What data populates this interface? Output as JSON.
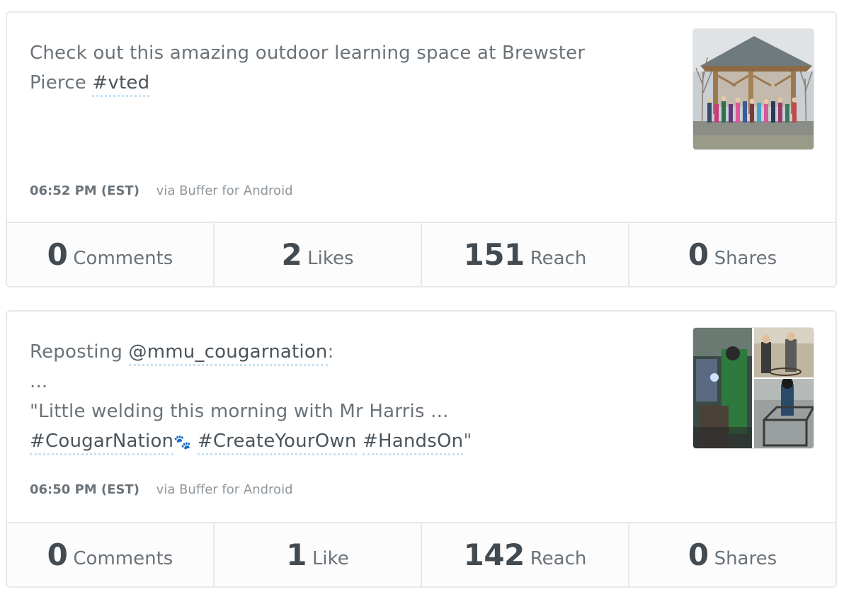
{
  "posts": [
    {
      "text_plain_1": "Check out this amazing outdoor learning space at Brewster Pierce ",
      "tag_1": "#vted",
      "time": "06:52 PM (EST)",
      "via": "via Buffer for Android",
      "stats": [
        {
          "value": "0",
          "label": "Comments"
        },
        {
          "value": "2",
          "label": "Likes"
        },
        {
          "value": "151",
          "label": "Reach"
        },
        {
          "value": "0",
          "label": "Shares"
        }
      ],
      "thumbnail_icon": "pavilion-photo"
    },
    {
      "text_plain_1": "Reposting ",
      "mention_1": "@mmu_cougarnation",
      "text_plain_2": ":",
      "text_line_2": "...",
      "text_line_3": "\"Little welding this morning with Mr Harris ...",
      "tag_1": "#CougarNation",
      "paw_icon": "🐾",
      "tag_2": "#CreateYourOwn",
      "tag_3": "#HandsOn",
      "closing_quote": "\"",
      "time": "06:50 PM (EST)",
      "via": "via Buffer for Android",
      "stats": [
        {
          "value": "0",
          "label": "Comments"
        },
        {
          "value": "1",
          "label": "Like"
        },
        {
          "value": "142",
          "label": "Reach"
        },
        {
          "value": "0",
          "label": "Shares"
        }
      ],
      "thumbnail_icon": "welding-collage-photo"
    }
  ]
}
